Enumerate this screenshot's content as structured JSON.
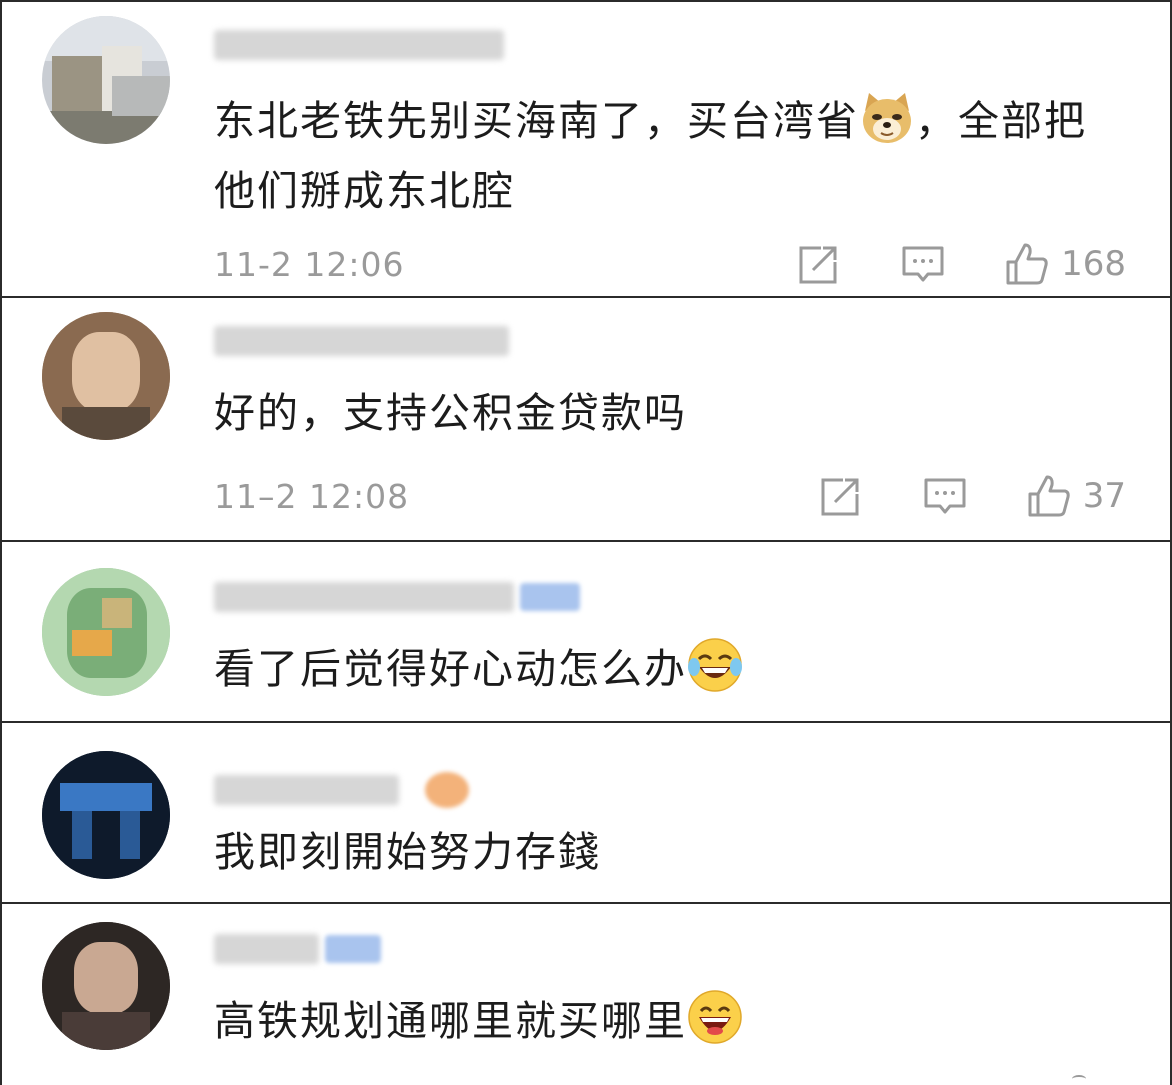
{
  "comments": [
    {
      "text": "东北老铁先别买海南了，买台湾省",
      "text_after_emoji": "，全部把他们掰成东北腔",
      "emoji": "doge-emoji",
      "time": "11-2 12:06",
      "likes": "168"
    },
    {
      "text": "好的，支持公积金贷款吗",
      "time": "11–2 12:08",
      "likes": "37"
    },
    {
      "text": "看了后觉得好心动怎么办",
      "emoji": "laughing-tears-emoji"
    },
    {
      "text": "我即刻開始努力存錢"
    },
    {
      "text": "高铁规划通哪里就买哪里",
      "emoji": "grinning-emoji"
    }
  ],
  "icons": {
    "share": "share-icon",
    "reply": "comment-icon",
    "like": "thumbs-up-icon"
  },
  "colors": {
    "text": "#1c1c1c",
    "meta": "#9a9a9a",
    "divider": "#2b2b2b"
  }
}
